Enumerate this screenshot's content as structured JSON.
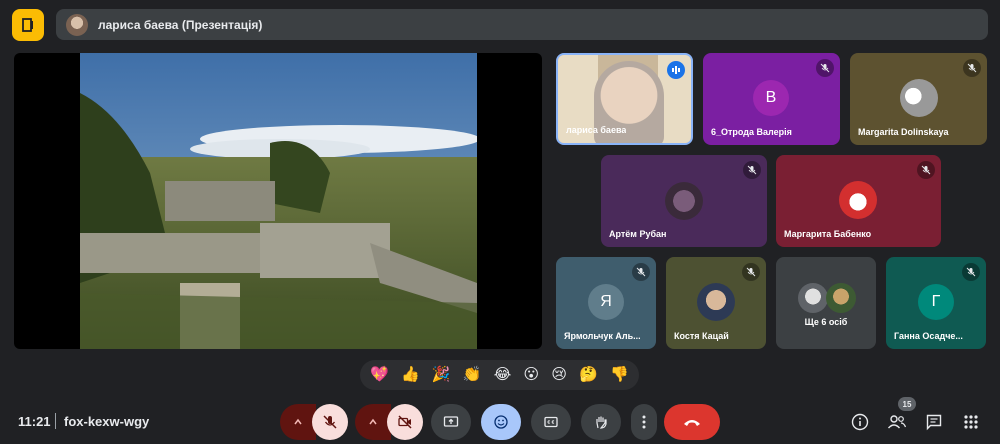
{
  "presenter_bar": {
    "title": "лариса баева (Презентація)"
  },
  "participants": {
    "larisa": {
      "name": "лариса баева"
    },
    "valeria": {
      "name": "6_Отрода Валерія",
      "initial": "В"
    },
    "margarita_d": {
      "name": "Margarita Dolinskaya"
    },
    "artem": {
      "name": "Артём Рубан"
    },
    "margarita_b": {
      "name": "Маргарита Бабенко"
    },
    "yarm": {
      "name": "Ярмольчук Аль...",
      "initial": "Я"
    },
    "kostya": {
      "name": "Костя Кацай"
    },
    "others": {
      "label": "Ще 6 осіб"
    },
    "ganna": {
      "name": "Ганна Осадче...",
      "initial": "Г"
    }
  },
  "reactions": [
    "💖",
    "👍",
    "🎉",
    "👏",
    "😂",
    "😮",
    "😢",
    "🤔",
    "👎"
  ],
  "footer": {
    "time": "11:21",
    "meeting_code": "fox-kexw-wgy",
    "participant_count": "15"
  },
  "colors": {
    "background": "#202124",
    "accent_blue": "#a8c7fa",
    "end_call_red": "#dc362e",
    "muted_pink": "#f9dedc",
    "badge_yellow": "#fbbc04"
  }
}
